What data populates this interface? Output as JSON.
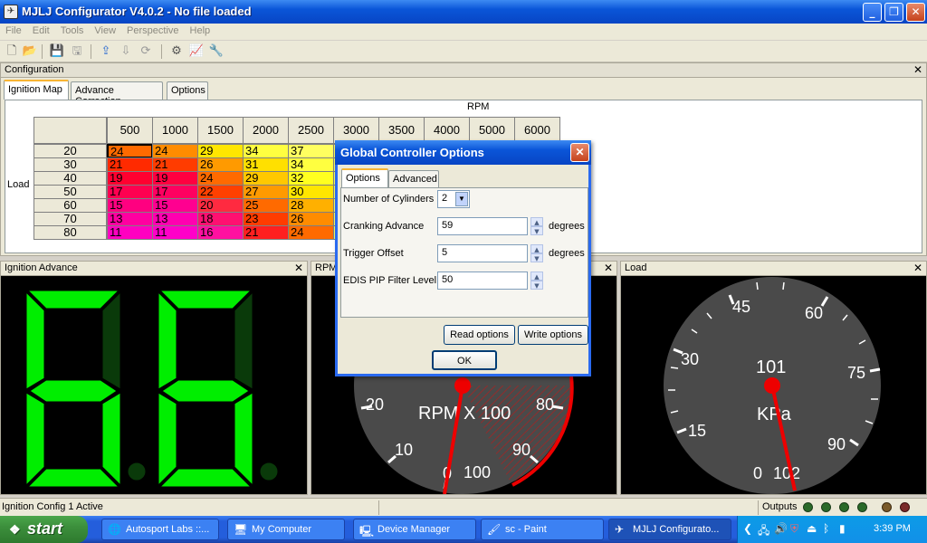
{
  "window": {
    "title": "MJLJ Configurator V4.0.2 - No file loaded"
  },
  "menu": [
    "File",
    "Edit",
    "Tools",
    "View",
    "Perspective",
    "Help"
  ],
  "config": {
    "title": "Configuration",
    "tabs": [
      "Ignition Map",
      "Advance Correction",
      "Options"
    ],
    "rpm_label": "RPM",
    "load_label": "Load",
    "rpm_headers": [
      "500",
      "1000",
      "1500",
      "2000",
      "2500",
      "3000",
      "3500",
      "4000",
      "5000",
      "6000"
    ],
    "load_rows": [
      "20",
      "30",
      "40",
      "50",
      "60",
      "70",
      "80"
    ],
    "cells": [
      [
        "24",
        "24",
        "29",
        "34",
        "37"
      ],
      [
        "21",
        "21",
        "26",
        "31",
        "34"
      ],
      [
        "19",
        "19",
        "24",
        "29",
        "32"
      ],
      [
        "17",
        "17",
        "22",
        "27",
        "30"
      ],
      [
        "15",
        "15",
        "20",
        "25",
        "28"
      ],
      [
        "13",
        "13",
        "18",
        "23",
        "26"
      ],
      [
        "11",
        "11",
        "16",
        "21",
        "24"
      ]
    ]
  },
  "ignition_panel": {
    "title": "Ignition Advance"
  },
  "rpm_panel": {
    "title": "RPM",
    "unit": "RPM X 100",
    "value": "100",
    "ticks": [
      "20",
      "10",
      "0",
      "80",
      "90"
    ]
  },
  "load_panel": {
    "title": "Load",
    "unit": "KPa",
    "value": "101",
    "ticks": [
      "45",
      "60",
      "30",
      "75",
      "15",
      "90",
      "0",
      "102"
    ]
  },
  "dialog": {
    "title": "Global Controller Options",
    "tabs": [
      "Options",
      "Advanced"
    ],
    "cylinders_label": "Number of Cylinders",
    "cylinders_value": "2",
    "cranking_label": "Cranking Advance",
    "cranking_value": "59",
    "trigger_label": "Trigger Offset",
    "trigger_value": "5",
    "edis_label": "EDIS PIP Filter Level",
    "edis_value": "50",
    "unit": "degrees",
    "read_btn": "Read options",
    "write_btn": "Write options",
    "ok_btn": "OK"
  },
  "status": {
    "text": "Ignition Config 1 Active",
    "outputs_label": "Outputs"
  },
  "taskbar": {
    "start": "start",
    "tasks": [
      "Autosport Labs ::...",
      "My Computer",
      "Device Manager",
      "sc - Paint",
      "MJLJ Configurato..."
    ],
    "clock": "3:39 PM"
  }
}
